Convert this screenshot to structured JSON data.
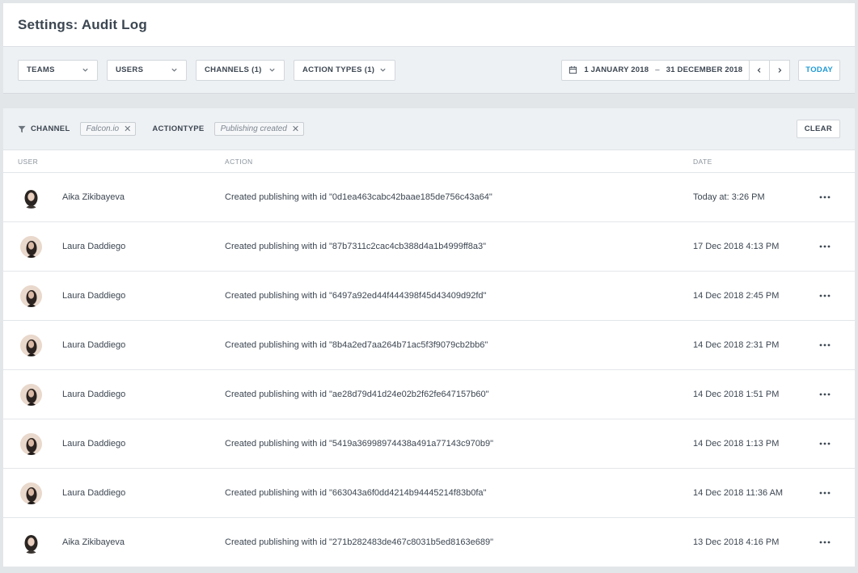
{
  "header": {
    "title": "Settings:  Audit Log"
  },
  "toolbar": {
    "dropdowns": [
      {
        "label": "TEAMS"
      },
      {
        "label": "USERS"
      },
      {
        "label": "CHANNELS (1)"
      },
      {
        "label": "ACTION TYPES (1)"
      }
    ],
    "date_start": "1 JANUARY 2018",
    "date_sep": "–",
    "date_end": "31 DECEMBER 2018",
    "today_label": "TODAY"
  },
  "filters": {
    "channel_label": "CHANNEL",
    "channel_value": "Falcon.io",
    "actiontype_label": "ACTIONTYPE",
    "actiontype_value": "Publishing created",
    "clear_label": "CLEAR"
  },
  "table": {
    "headers": {
      "user": "USER",
      "action": "ACTION",
      "date": "DATE"
    },
    "rows": [
      {
        "user": "Aika Zikibayeva",
        "action": "Created publishing with id \"0d1ea463cabc42baae185de756c43a64\"",
        "date": "Today at: 3:26 PM",
        "avatar": "a"
      },
      {
        "user": "Laura Daddiego",
        "action": "Created publishing with id \"87b7311c2cac4cb388d4a1b4999ff8a3\"",
        "date": "17 Dec 2018 4:13 PM",
        "avatar": "l"
      },
      {
        "user": "Laura Daddiego",
        "action": "Created publishing with id \"6497a92ed44f444398f45d43409d92fd\"",
        "date": "14 Dec 2018 2:45 PM",
        "avatar": "l"
      },
      {
        "user": "Laura Daddiego",
        "action": "Created publishing with id \"8b4a2ed7aa264b71ac5f3f9079cb2bb6\"",
        "date": "14 Dec 2018 2:31 PM",
        "avatar": "l"
      },
      {
        "user": "Laura Daddiego",
        "action": "Created publishing with id \"ae28d79d41d24e02b2f62fe647157b60\"",
        "date": "14 Dec 2018 1:51 PM",
        "avatar": "l"
      },
      {
        "user": "Laura Daddiego",
        "action": "Created publishing with id \"5419a36998974438a491a77143c970b9\"",
        "date": "14 Dec 2018 1:13 PM",
        "avatar": "l"
      },
      {
        "user": "Laura Daddiego",
        "action": "Created publishing with id \"663043a6f0dd4214b94445214f83b0fa\"",
        "date": "14 Dec 2018 11:36 AM",
        "avatar": "l"
      },
      {
        "user": "Aika Zikibayeva",
        "action": "Created publishing with id \"271b282483de467c8031b5ed8163e689\"",
        "date": "13 Dec 2018 4:16 PM",
        "avatar": "a"
      }
    ]
  },
  "colors": {
    "accent": "#1f9ad6",
    "text": "#3c4651",
    "muted": "#8a939c"
  }
}
